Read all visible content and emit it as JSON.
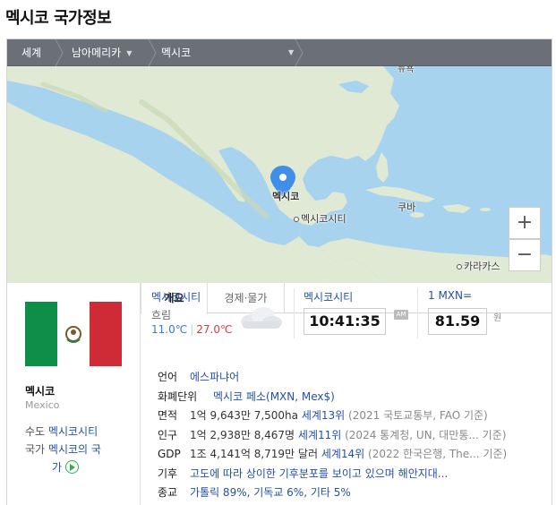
{
  "page_title": "멕시코 국가정보",
  "breadcrumb": {
    "items": [
      {
        "label": "세계"
      },
      {
        "label": "남아메리카",
        "caret": "▼"
      },
      {
        "label": "멕시코",
        "caret": "▼"
      }
    ]
  },
  "map": {
    "labels": {
      "pin_label": "멕시코",
      "mexico_city": "멕시코시티",
      "cuba": "쿠바",
      "caracas": "카라카스",
      "top_clipped": "뉴욕"
    },
    "zoom_in": "+",
    "zoom_out": "−",
    "colors": {
      "water": "#a8d3ee",
      "land": "#dfe9d3",
      "pin": "#3f8ee8"
    }
  },
  "country": {
    "name": "멕시코",
    "name_en": "Mexico",
    "capital_label": "수도",
    "capital_value": "멕시코시티",
    "anthem_label": "국가",
    "anthem_value_1": "멕시코의 국",
    "anthem_value_2": "가",
    "flag_colors": {
      "green": "#0e8f48",
      "white": "#ffffff",
      "red": "#ce2b37"
    }
  },
  "tabs": [
    {
      "label": "개요",
      "active": true
    },
    {
      "label": "경제·물가",
      "active": false
    }
  ],
  "weather": {
    "city": "멕시코시티",
    "condition": "흐림",
    "low": "11.0℃",
    "high": "27.0℃",
    "icon": "cloud-icon"
  },
  "clock": {
    "city": "멕시코시티",
    "time": "10:41:35",
    "ampm": "AM"
  },
  "exchange": {
    "label": "1 MXN=",
    "value": "81.59",
    "unit": "원"
  },
  "facts": [
    {
      "key": "언어",
      "parts": [
        {
          "t": "에스파냐어",
          "c": "lk"
        }
      ]
    },
    {
      "key": "화폐단위",
      "parts": [
        {
          "t": "멕시코 페소(MXN, Mex$)",
          "c": "lk"
        }
      ]
    },
    {
      "key": "면적",
      "parts": [
        {
          "t": "1억 9,643만 7,500ha ",
          "c": "v"
        },
        {
          "t": "세계13위",
          "c": "lk"
        },
        {
          "t": " (2021 국토교통부, FAO 기준)",
          "c": "gr"
        }
      ]
    },
    {
      "key": "인구",
      "parts": [
        {
          "t": "1억 2,938만 8,467명 ",
          "c": "v"
        },
        {
          "t": "세계11위",
          "c": "lk"
        },
        {
          "t": " (2024 통계청, UN, 대만통... 기준)",
          "c": "gr"
        }
      ]
    },
    {
      "key": "GDP",
      "parts": [
        {
          "t": "1조 4,141억 8,719만 달러 ",
          "c": "v"
        },
        {
          "t": "세계14위",
          "c": "lk"
        },
        {
          "t": " (2022 한국은행, The... 기준)",
          "c": "gr"
        }
      ]
    },
    {
      "key": "기후",
      "parts": [
        {
          "t": "고도에 따라 상이한 기후분포를 보이고 있으며 해안지대...",
          "c": "lk"
        }
      ]
    },
    {
      "key": "종교",
      "parts": [
        {
          "t": "가톨릭 89%, 기독교 6%, 기타 5%",
          "c": "lk"
        }
      ]
    }
  ]
}
